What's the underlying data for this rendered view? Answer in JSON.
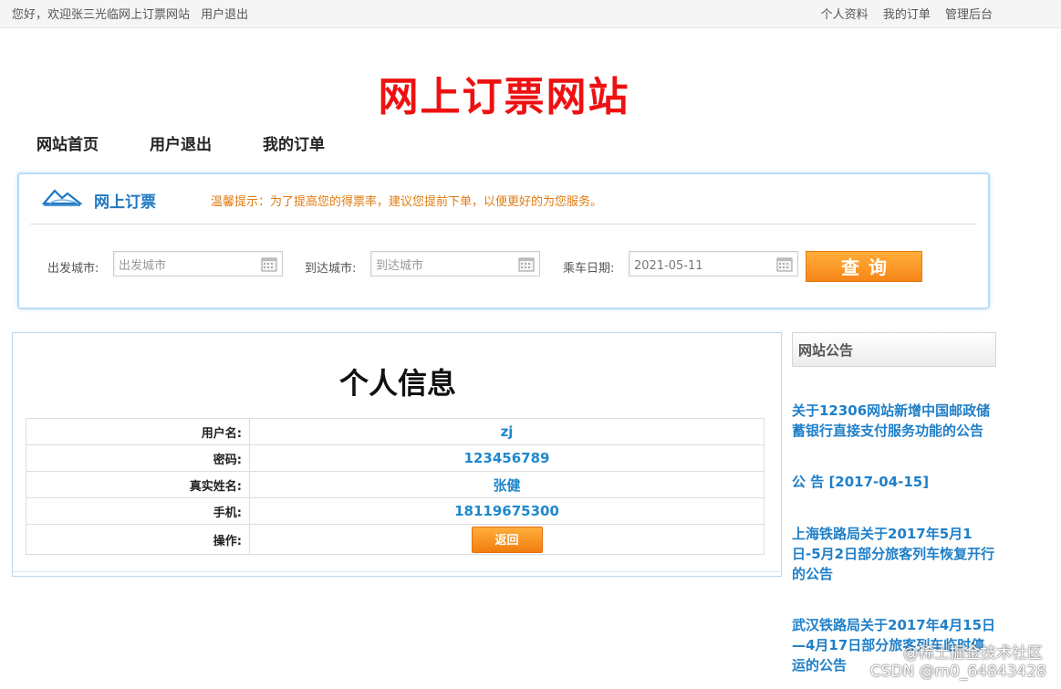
{
  "topbar": {
    "greeting": "您好，欢迎张三光临网上订票网站",
    "logout": "用户退出",
    "links": [
      "个人资料",
      "我的订单",
      "管理后台"
    ]
  },
  "site_title": "网上订票网站",
  "nav": [
    "网站首页",
    "用户退出",
    "我的订单"
  ],
  "booking": {
    "title": "网上订票",
    "tip": "温馨提示：为了提高您的得票率，建议您提前下单，以便更好的为您服务。",
    "from_label": "出发城市:",
    "from_placeholder": "出发城市",
    "to_label": "到达城市:",
    "to_placeholder": "到达城市",
    "date_label": "乘车日期:",
    "date_value": "2021-05-11",
    "search_label": "查询"
  },
  "profile": {
    "title": "个人信息",
    "rows": [
      {
        "label": "用户名:",
        "value": "zj"
      },
      {
        "label": "密码:",
        "value": "123456789"
      },
      {
        "label": "真实姓名:",
        "value": "张健"
      },
      {
        "label": "手机:",
        "value": "18119675300"
      }
    ],
    "action_label": "操作:",
    "back_label": "返回"
  },
  "notices": {
    "title": "网站公告",
    "items": [
      "关于12306网站新增中国邮政储蓄银行直接支付服务功能的公告",
      "公 告 [2017-04-15]",
      "上海铁路局关于2017年5月1日-5月2日部分旅客列车恢复开行的公告",
      "武汉铁路局关于2017年4月15日—4月17日部分旅客列车临时停运的公告"
    ]
  },
  "watermark": {
    "line1": "@稀土掘金技术社区",
    "line2": "CSDN @m0_64843428"
  },
  "colors": {
    "title_red": "#ee1111",
    "link_blue": "#1f7fc8",
    "button_orange": "#f7861a",
    "tip_orange": "#e07b10"
  }
}
